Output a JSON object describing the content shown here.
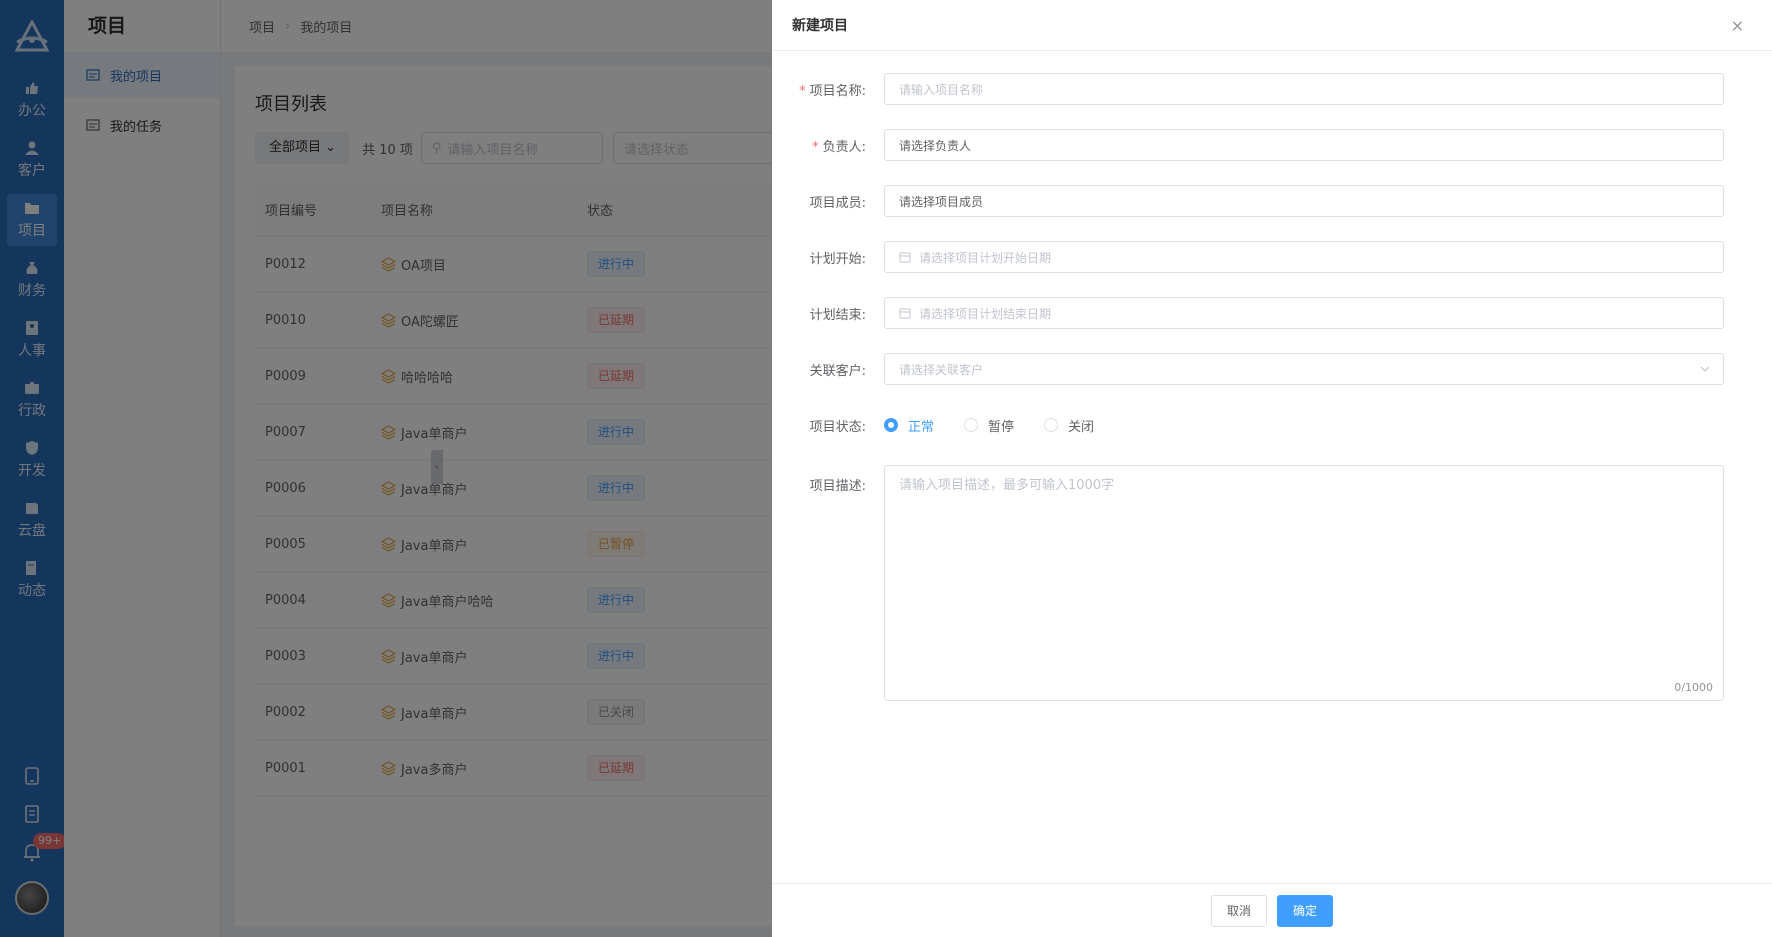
{
  "rail": {
    "nav": [
      {
        "label": "办公",
        "icon": "thumb-up-icon"
      },
      {
        "label": "客户",
        "icon": "user-icon"
      },
      {
        "label": "项目",
        "icon": "folder-icon"
      },
      {
        "label": "财务",
        "icon": "money-bag-icon"
      },
      {
        "label": "人事",
        "icon": "id-card-icon"
      },
      {
        "label": "行政",
        "icon": "briefcase-icon"
      },
      {
        "label": "开发",
        "icon": "shield-icon"
      },
      {
        "label": "云盘",
        "icon": "cloud-disk-icon"
      },
      {
        "label": "动态",
        "icon": "document-icon"
      }
    ],
    "badge": "99+"
  },
  "subbar": {
    "title": "项目",
    "items": [
      {
        "label": "我的项目"
      },
      {
        "label": "我的任务"
      }
    ]
  },
  "breadcrumb": {
    "root": "项目",
    "current": "我的项目"
  },
  "list": {
    "title": "项目列表",
    "filter_select": "全部项目",
    "count": "共 10 项",
    "search_placeholder": "请输入项目名称",
    "status_placeholder": "请选择状态",
    "columns": [
      "项目编号",
      "项目名称",
      "状态"
    ],
    "rows": [
      {
        "id": "P0012",
        "name": "OA项目",
        "status": "进行中",
        "tone": "blue"
      },
      {
        "id": "P0010",
        "name": "OA陀螺匠",
        "status": "已延期",
        "tone": "red"
      },
      {
        "id": "P0009",
        "name": "哈哈哈哈",
        "status": "已延期",
        "tone": "red"
      },
      {
        "id": "P0007",
        "name": "Java单商户",
        "status": "进行中",
        "tone": "blue"
      },
      {
        "id": "P0006",
        "name": "Java单商户",
        "status": "进行中",
        "tone": "blue"
      },
      {
        "id": "P0005",
        "name": "Java单商户",
        "status": "已暂停",
        "tone": "orange"
      },
      {
        "id": "P0004",
        "name": "Java单商户哈哈",
        "status": "进行中",
        "tone": "blue"
      },
      {
        "id": "P0003",
        "name": "Java单商户",
        "status": "进行中",
        "tone": "blue"
      },
      {
        "id": "P0002",
        "name": "Java单商户",
        "status": "已关闭",
        "tone": "gray"
      },
      {
        "id": "P0001",
        "name": "Java多商户",
        "status": "已延期",
        "tone": "red"
      }
    ]
  },
  "drawer": {
    "title": "新建项目",
    "close": "×",
    "fields": {
      "name_label": "项目名称:",
      "name_placeholder": "请输入项目名称",
      "owner_label": "负责人:",
      "owner_value": "请选择负责人",
      "members_label": "项目成员:",
      "members_value": "请选择项目成员",
      "start_label": "计划开始:",
      "start_placeholder": "请选择项目计划开始日期",
      "end_label": "计划结束:",
      "end_placeholder": "请选择项目计划结束日期",
      "customer_label": "关联客户:",
      "customer_placeholder": "请选择关联客户",
      "status_label": "项目状态:",
      "status_options": [
        "正常",
        "暂停",
        "关闭"
      ],
      "desc_label": "项目描述:",
      "desc_placeholder": "请输入项目描述，最多可输入1000字",
      "desc_count": "0/1000"
    },
    "cancel": "取消",
    "ok": "确定"
  },
  "colors": {
    "rail": "#2a6cb8",
    "primary": "#409eff",
    "danger": "#f56c6c",
    "warning": "#e6a23c"
  }
}
